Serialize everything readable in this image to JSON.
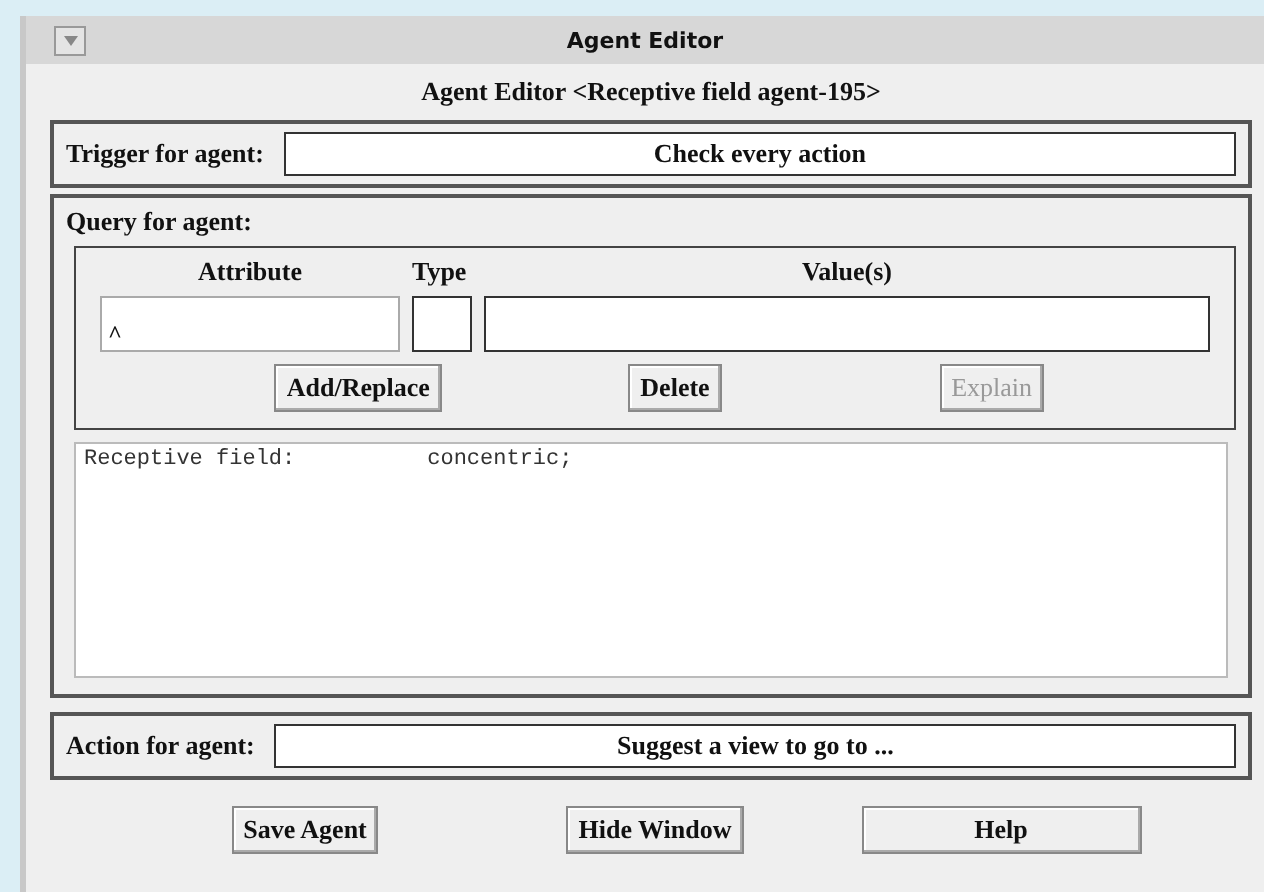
{
  "window": {
    "title": "Agent Editor"
  },
  "heading": "Agent Editor <Receptive field agent-195>",
  "trigger": {
    "label": "Trigger for agent:",
    "value": "Check every action"
  },
  "query": {
    "label": "Query for agent:",
    "columns": [
      "Attribute",
      "Type",
      "Value(s)"
    ],
    "attribute_value": "^",
    "buttons": [
      {
        "label": "Add/Replace",
        "disabled": false
      },
      {
        "label": "Delete",
        "disabled": false
      },
      {
        "label": "Explain",
        "disabled": true
      }
    ],
    "entries": [
      {
        "attribute": "Receptive field:",
        "value": "concentric;"
      }
    ]
  },
  "action": {
    "label": "Action for agent:",
    "value": "Suggest a view to go to ..."
  },
  "buttons": [
    "Save Agent",
    "Hide Window",
    "Help"
  ]
}
